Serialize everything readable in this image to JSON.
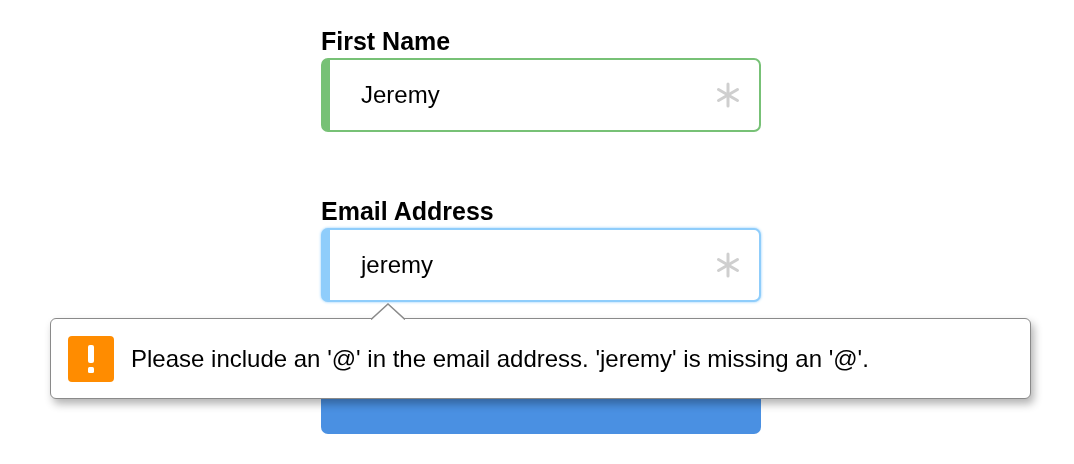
{
  "fields": [
    {
      "label": "First Name",
      "value": "Jeremy",
      "required": true,
      "valid": true,
      "focused": false
    },
    {
      "label": "Email Address",
      "value": "jeremy",
      "required": true,
      "valid": false,
      "focused": true
    }
  ],
  "submit_button": {
    "disabled": false
  },
  "validation_tooltip": {
    "kind": "warning",
    "message": "Please include an '@' in the email address. 'jeremy' is missing an '@'."
  }
}
